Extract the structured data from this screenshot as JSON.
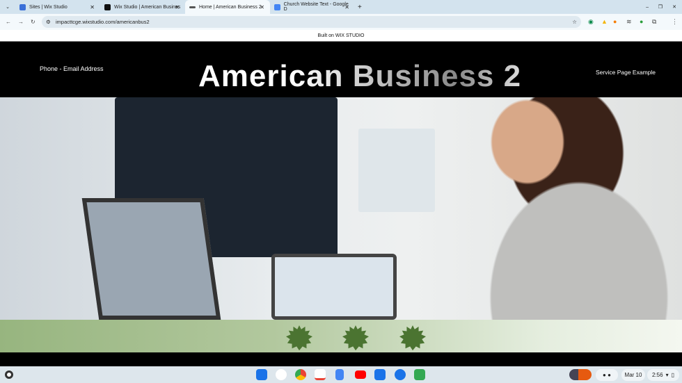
{
  "browser": {
    "tabs": [
      {
        "title": "Sites | Wix Studio",
        "active": false
      },
      {
        "title": "Wix Studio | American Busines",
        "active": false
      },
      {
        "title": "Home | American Business 2",
        "active": true
      },
      {
        "title": "Church Website Text - Google D",
        "active": false
      }
    ],
    "url": "impacttcge.wixstudio.com/americanbus2"
  },
  "site": {
    "built_on": "Built on WIX STUDIO",
    "contact": "Phone - Email Address",
    "title": "American Business 2",
    "nav_link": "Service Page Example",
    "accent_green": "#4b7431"
  },
  "shelf": {
    "date": "Mar 10",
    "time": "2:56"
  }
}
